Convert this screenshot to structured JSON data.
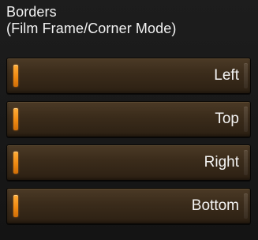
{
  "panel": {
    "title_line1": "Borders",
    "title_line2": "(Film Frame/Corner Mode)"
  },
  "sliders": [
    {
      "label": "Left",
      "value": 0
    },
    {
      "label": "Top",
      "value": 0
    },
    {
      "label": "Right",
      "value": 0
    },
    {
      "label": "Bottom",
      "value": 0
    }
  ],
  "colors": {
    "handle": "#f08a12",
    "slider_bg": "#3b2c1b",
    "panel_bg": "#161616",
    "text": "#f2f2f2"
  }
}
